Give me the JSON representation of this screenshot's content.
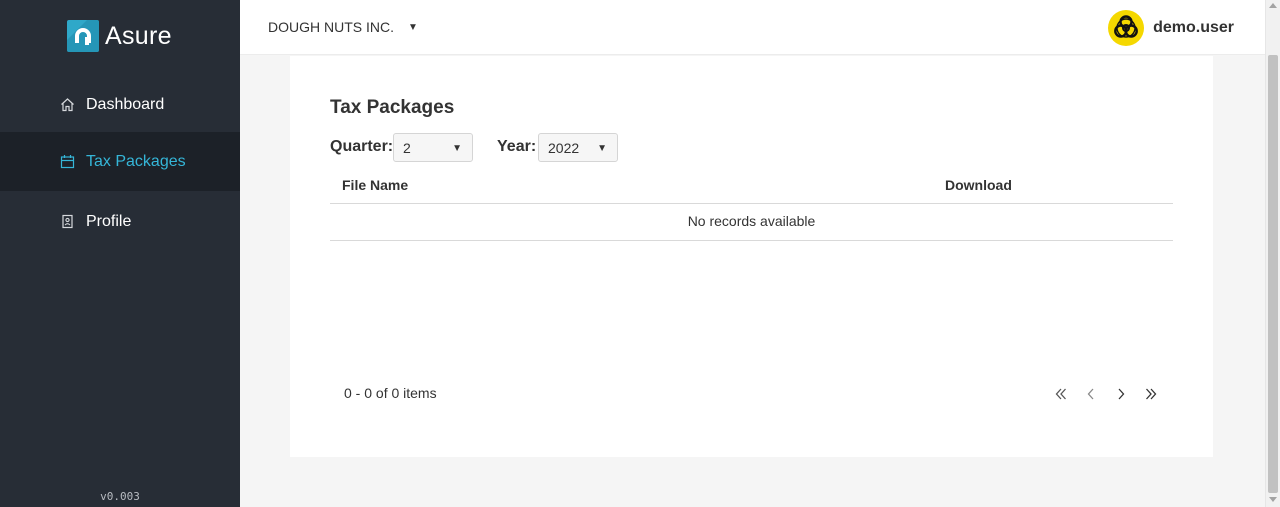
{
  "app": {
    "brand": "Asure",
    "version": "v0.003"
  },
  "sidebar": {
    "items": [
      {
        "label": "Dashboard",
        "icon": "home-icon",
        "active": false
      },
      {
        "label": "Tax Packages",
        "icon": "calendar-icon",
        "active": true
      },
      {
        "label": "Profile",
        "icon": "profile-badge-icon",
        "active": false
      }
    ]
  },
  "header": {
    "company": "DOUGH NUTS INC.",
    "username": "demo.user",
    "avatar_icon": "biohazard-icon"
  },
  "main": {
    "title": "Tax Packages",
    "filters": {
      "quarter_label": "Quarter:",
      "quarter_value": "2",
      "year_label": "Year:",
      "year_value": "2022"
    },
    "grid": {
      "columns": [
        "File Name",
        "Download"
      ],
      "empty_message": "No records available"
    },
    "pager": {
      "info": "0 - 0 of 0 items"
    }
  },
  "colors": {
    "sidebar_bg": "#272d36",
    "active_bg": "#1c2128",
    "accent": "#35b6d8",
    "avatar_bg": "#f5d800"
  }
}
